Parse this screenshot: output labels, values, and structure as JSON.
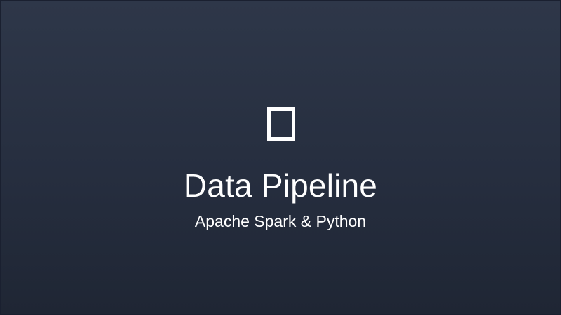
{
  "splash": {
    "icon": "missing-glyph-icon",
    "title": "Data Pipeline",
    "subtitle": "Apache Spark & Python"
  },
  "colors": {
    "background_top": "#2e3749",
    "background_bottom": "#1f2634",
    "text": "#ffffff"
  }
}
